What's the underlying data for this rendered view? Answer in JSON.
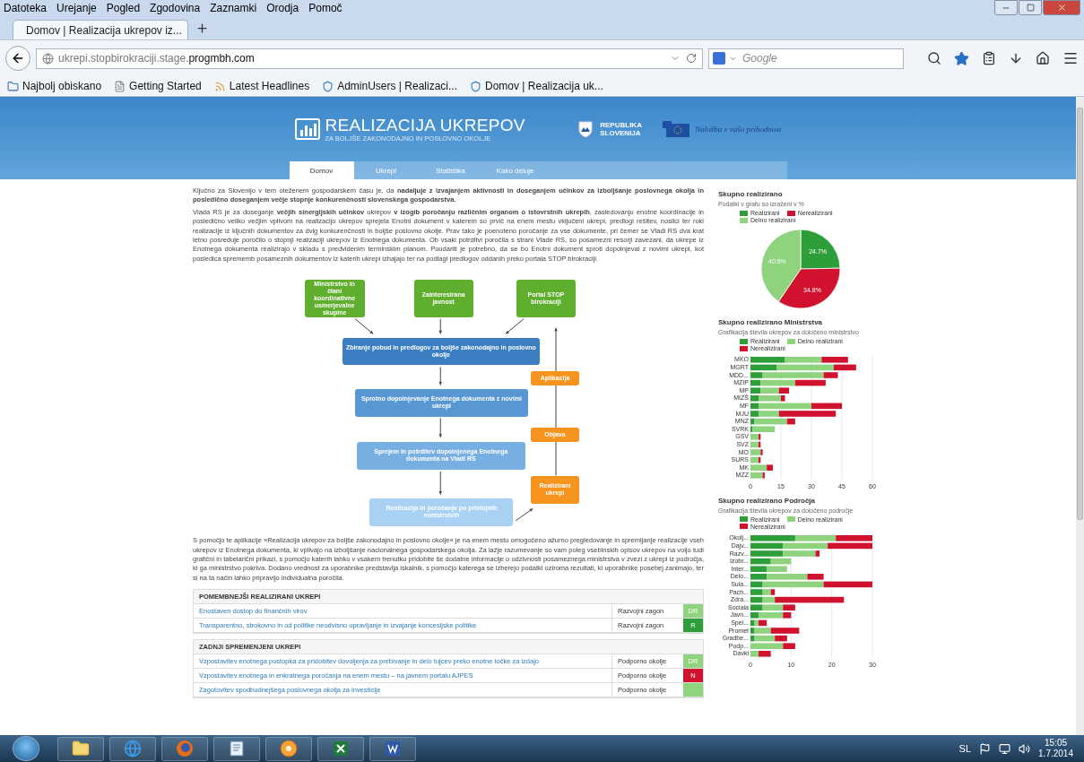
{
  "menu": [
    "Datoteka",
    "Urejanje",
    "Pogled",
    "Zgodovina",
    "Zaznamki",
    "Orodja",
    "Pomoč"
  ],
  "tabs": [
    {
      "label": "Domov | Realizacija ukrepov iz...",
      "selected": true
    }
  ],
  "address": {
    "url_host": "ukrepi.stopbirokraciji.stage.",
    "url_domain": "progmbh.com",
    "search_placeholder": "Google"
  },
  "bookmarks": [
    {
      "kind": "places",
      "label": "Najbolj obiskano"
    },
    {
      "kind": "page",
      "label": "Getting Started"
    },
    {
      "kind": "feed",
      "label": "Latest Headlines"
    },
    {
      "kind": "site",
      "label": "AdminUsers | Realizaci..."
    },
    {
      "kind": "site",
      "label": "Domov | Realizacija uk..."
    }
  ],
  "site": {
    "title": "REALIZACIJA UKREPOV",
    "subtitle": "ZA BOLJŠE ZAKONODAJNO IN POSLOVNO OKOLJE",
    "republic": "REPUBLIKA SLOVENIJA",
    "eu_slogan": "Naložba v vašo prihodnost",
    "nav": [
      {
        "label": "Domov",
        "selected": true
      },
      {
        "label": "Ukrepi",
        "selected": false
      },
      {
        "label": "Statistika",
        "selected": false
      },
      {
        "label": "Kako deluje",
        "selected": false
      }
    ]
  },
  "content": {
    "intro": [
      "Ključno za Slovenijo v tem oteženem gospodarskem času je, da **nadaljuje z izvajanjem aktivnosti in doseganjem učinkov za izboljšanje poslovnega okolja in posledično doseganjem večje stopnje konkurenčnosti slovenskega gospodarstva.**",
      "Vlada RS je za doseganje **večjih sinergijskih učinkov** ukrepov **v izogib poročanju različnim organom o istovrstnih ukrepih**, zasledovanju enotne koordinacije in posledično veliko večjim vplivom na realizacijo ukrepov sprejela Enotni dokument v katerem so prvič na enem mestu vključeni ukrepi, predlogi rešitev, nosilci ter roki realizacije iz ključnih dokumentov za dvig konkurenčnosti in boljše poslovno okolje. Prav tako je poenoteno poročanje za vse dokumente, pri čemer se Vladi RS dva krat letno posreduje poročilo o stopnji realizaciji ukrepov iz Enotnega dokumenta. Ob vsaki potrditvi poročila s strani Vlade RS, so posamezni resorji zavezani, da ukrepe iz Enotnega dokumenta realizirajo v skladu s predvidenim terminskim planom. Poudariti je potrebno, da se bo Enotni dokument sproti dopolnjeval z novimi ukrepi, kot posledica sprememb posameznih dokumentov iz katerih ukrepi izhajajo ter na podlagi predlogov oddanih preko portala STOP birokraciji."
    ],
    "flowchart": [
      {
        "kind": "source",
        "text": "Ministrstvo in člani koordinativne usmerjevalne skupine"
      },
      {
        "kind": "source",
        "text": "Zainteresirana javnost"
      },
      {
        "kind": "source",
        "text": "Portal STOP birokraciji"
      },
      {
        "kind": "step",
        "text": "Zbiranje pobud in predlogov za boljše zakonodajno in poslovno okolje"
      },
      {
        "kind": "step",
        "text": "Sprotno dopolnjevanje Enotnega dokumenta z novimi ukrepi"
      },
      {
        "kind": "step",
        "text": "Sprejem in potrditev dopolnjenega Enotnega dokumenta na Vladi RS"
      },
      {
        "kind": "step",
        "text": "Realizacija in poročanje po pristojnih ministrstvih"
      },
      {
        "kind": "output",
        "text": "Aplikacija"
      },
      {
        "kind": "output",
        "text": "Objava"
      },
      {
        "kind": "output",
        "text": "Realizirani ukrepi"
      }
    ],
    "outro": "S pomočjo te aplikacije »Realizacija ukrepov za boljše zakonodajno in poslovno okolje« je na enem mestu omogočeno ažurno pregledovanje in spremljanje realizacije vseh ukrepov iz Enotnega dokumenta, ki vplivajo na izboljšanje nacionalnega gospodarskega okolja. Za lažje razumevanje so vam poleg vsebinskih opisov ukrepov na voljo tudi grafični in tabelarični prikazi, s pomočjo katerih lahko v vsakem trenutku pridobite še dodatne informacije o odzivnosti posameznega ministrstva v zvezi z ukrepi iz področja, ki ga ministrstvo pokriva. Dodano vrednost za uporabnike predstavlja iskalnik, s pomočjo katerega se izberejo podatki oziroma rezultati, ki uporabnike posebej zanimajo, ter si na ta način lahko pripravijo individualna poročila.",
    "tables": [
      {
        "title": "POMEMBNEJŠI REALIZIRANI UKREPI",
        "rows": [
          {
            "title": "Enostaven dostop do finančnih virov",
            "area": "Razvojni zagon",
            "status": "DR",
            "color": "#8fd37f"
          },
          {
            "title": "Transparentno, strokovno in od politike neodvisno upravljanje in izvajanje koncesijske politike",
            "area": "Razvojni zagon",
            "status": "R",
            "color": "#2e9e3b"
          }
        ]
      },
      {
        "title": "ZADNJI SPREMENJENI UKREPI",
        "rows": [
          {
            "title": "Vzpostavitev enotnega postopka za pridobitev dovoljenja za prebivanje in delo tujcev preko enotne točke za izdajo",
            "area": "Podporno okolje",
            "status": "DR",
            "color": "#8fd37f"
          },
          {
            "title": "Vzpostavitev enotnega in enkratnega poročanja na enem mestu – na javnem portalu AJPES",
            "area": "Podporno okolje",
            "status": "N",
            "color": "#d0122f"
          },
          {
            "title": "Zagotovitev spodbudnejšega poslovnega okolja za investicije",
            "area": "Podporno okolje",
            "color": "#8fd37f"
          }
        ]
      }
    ]
  },
  "sidebar": [
    {
      "title": "Skupno realizirano",
      "subtitle": "Podatki v grafu so izraženi v %",
      "chart_data": {
        "type": "pie",
        "categories": [
          "Realizirani",
          "Nerealizirani",
          "Delno realizirani"
        ],
        "values": [
          24.7,
          34.8,
          40.5
        ],
        "colors": [
          "#2e9e3b",
          "#d0122f",
          "#8fd37f"
        ],
        "value_labels": [
          "24.7%",
          "34.8%",
          "40.5%"
        ]
      }
    },
    {
      "title": "Skupno realizirano Ministrstva",
      "subtitle": "Grafikacija števila ukrepov za določeno ministrstvo",
      "chart_data": {
        "type": "bar",
        "orientation": "horizontal",
        "stacked": true,
        "categories": [
          "MKO",
          "MGRT",
          "MDD...",
          "MZIP",
          "MP",
          "MIZŠ",
          "MF",
          "MJU",
          "MNZ",
          "SVRK",
          "GSV",
          "SVZ",
          "MO",
          "SURS",
          "MK",
          "MZZ"
        ],
        "series": [
          {
            "name": "Realizirani",
            "color": "#2e9e3b",
            "values": [
              17,
              13,
              6,
              5,
              5,
              4,
              4,
              4,
              2,
              1,
              0,
              0,
              0,
              0,
              0,
              0
            ]
          },
          {
            "name": "Delno realizirani",
            "color": "#8fd37f",
            "values": [
              18,
              28,
              30,
              17,
              9,
              11,
              26,
              10,
              16,
              11,
              4,
              4,
              5,
              4,
              8,
              6
            ]
          },
          {
            "name": "Nerealizirani",
            "color": "#d0122f",
            "values": [
              13,
              11,
              7,
              15,
              5,
              2,
              15,
              28,
              4,
              0,
              1,
              1,
              1,
              1,
              3,
              1
            ]
          }
        ],
        "xlim": [
          0,
          60
        ],
        "xticks": [
          0,
          15,
          30,
          45,
          60
        ],
        "grid": true
      }
    },
    {
      "title": "Skupno realizirano Področja",
      "subtitle": "Grafikacija števila ukrepov za določeno področje",
      "chart_data": {
        "type": "bar",
        "orientation": "horizontal",
        "stacked": true,
        "categories": [
          "Okolj...",
          "Dajv...",
          "Razv...",
          "Izobr...",
          "Inter...",
          "Delo...",
          "Sula...",
          "Pach...",
          "Zdra...",
          "Sociala",
          "Javn...",
          "Spel...",
          "Promet",
          "Gradbe...",
          "Podp...",
          "Davki"
        ],
        "series": [
          {
            "name": "Realizirani",
            "color": "#2e9e3b",
            "values": [
              11,
              8,
              8,
              5,
              4,
              4,
              3,
              3,
              3,
              3,
              2,
              1,
              1,
              1,
              0,
              0
            ]
          },
          {
            "name": "Delno realizirani",
            "color": "#8fd37f",
            "values": [
              10,
              11,
              8,
              5,
              5,
              10,
              15,
              2,
              3,
              5,
              6,
              1,
              4,
              5,
              8,
              2
            ]
          },
          {
            "name": "Nerealizirani",
            "color": "#d0122f",
            "values": [
              9,
              11,
              1,
              0,
              0,
              4,
              12,
              1,
              17,
              3,
              2,
              2,
              7,
              3,
              3,
              3
            ]
          }
        ],
        "xlim": [
          0,
          30
        ],
        "xticks": [
          0,
          10,
          20,
          30
        ],
        "grid": true
      }
    }
  ],
  "taskbar": {
    "apps": [
      {
        "kind": "folder"
      },
      {
        "kind": "ie"
      },
      {
        "kind": "firefox"
      },
      {
        "kind": "notepad"
      },
      {
        "kind": "disc"
      },
      {
        "kind": "excel"
      },
      {
        "kind": "word"
      }
    ],
    "language": "SL",
    "time": "15:05",
    "date": "1.7.2014"
  }
}
